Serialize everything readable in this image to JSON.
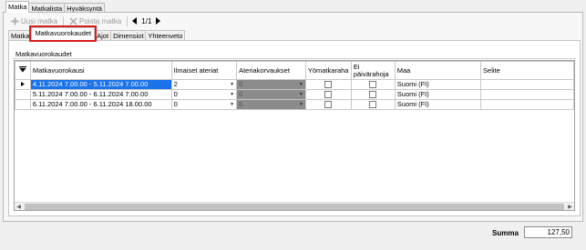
{
  "top_tabs": [
    {
      "label": "Matka"
    },
    {
      "label": "Matkalista"
    },
    {
      "label": "Hyväksyntä"
    }
  ],
  "toolbar": {
    "new_trip": "Uusi matka",
    "delete_trip": "Poista matka",
    "page_indicator": "1/1"
  },
  "sub_tabs": [
    {
      "label": "Matka"
    },
    {
      "label": "Matkavuorokaudet"
    },
    {
      "label": "Ajot"
    },
    {
      "label": "Dimensiot"
    },
    {
      "label": "Yhteenveto"
    }
  ],
  "group": {
    "caption": "Matkavuorokaudet"
  },
  "grid": {
    "columns": {
      "period": "Matkavuorokausi",
      "free_meals": "Ilmaiset ateriat",
      "meal_compensation": "Ateriakorvaukset",
      "night_allowance": "Yömatkaraha",
      "no_daily_allowance": "Ei päivärahoja",
      "country": "Maa",
      "explanation": "Selite"
    },
    "rows": [
      {
        "period": "4.11.2024 7.00.00 - 5.11.2024 7.00.00",
        "free_meals": "2",
        "meal_compensation": "0",
        "country": "Suomi (FI)",
        "explanation": ""
      },
      {
        "period": "5.11.2024 7.00.00 - 6.11.2024 7.00.00",
        "free_meals": "0",
        "meal_compensation": "0",
        "country": "Suomi (FI)",
        "explanation": ""
      },
      {
        "period": "6.11.2024 7.00.00 - 6.11.2024 18.00.00",
        "free_meals": "0",
        "meal_compensation": "0",
        "country": "Suomi (FI)",
        "explanation": ""
      }
    ]
  },
  "footer": {
    "sum_label": "Summa",
    "sum_value": "127,50"
  },
  "colors": {
    "selection": "#1a73e8",
    "highlight_border": "#d81e1e",
    "disabled_cell": "#8c8c8c"
  }
}
